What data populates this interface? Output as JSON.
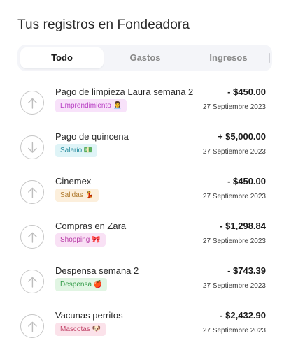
{
  "page": {
    "title": "Tus registros en Fondeadora"
  },
  "tabs": [
    {
      "label": "Todo",
      "active": true
    },
    {
      "label": "Gastos",
      "active": false
    },
    {
      "label": "Ingresos",
      "active": false
    }
  ],
  "transactions": [
    {
      "direction": "out",
      "icon": "arrow-up-icon",
      "name": "Pago de limpieza Laura semana 2",
      "amount": "- $450.00",
      "category": "Emprendimiento 👩‍💼",
      "category_bg": "#f8e2fa",
      "category_color": "#b93ec4",
      "date": "27 Septiembre 2023"
    },
    {
      "direction": "in",
      "icon": "arrow-down-icon",
      "name": "Pago de quincena",
      "amount": "+ $5,000.00",
      "category": "Salario 💵",
      "category_bg": "#dff4f7",
      "category_color": "#2a8ea0",
      "date": "27 Septiembre 2023"
    },
    {
      "direction": "out",
      "icon": "arrow-up-icon",
      "name": "Cinemex",
      "amount": "- $450.00",
      "category": "Salidas 💃",
      "category_bg": "#fcefdc",
      "category_color": "#b07a2e",
      "date": "27 Septiembre 2023"
    },
    {
      "direction": "out",
      "icon": "arrow-up-icon",
      "name": "Compras en Zara",
      "amount": "- $1,298.84",
      "category": "Shopping 🎀",
      "category_bg": "#f9e1f5",
      "category_color": "#b83aa6",
      "date": "27 Septiembre 2023"
    },
    {
      "direction": "out",
      "icon": "arrow-up-icon",
      "name": "Despensa semana 2",
      "amount": "- $743.39",
      "category": "Despensa 🍎",
      "category_bg": "#e1f5e3",
      "category_color": "#2f9a45",
      "date": "27 Septiembre 2023"
    },
    {
      "direction": "out",
      "icon": "arrow-up-icon",
      "name": "Vacunas perritos",
      "amount": "- $2,432.90",
      "category": "Mascotas 🐶",
      "category_bg": "#fbe2ea",
      "category_color": "#c2476b",
      "date": "27 Septiembre 2023"
    }
  ]
}
